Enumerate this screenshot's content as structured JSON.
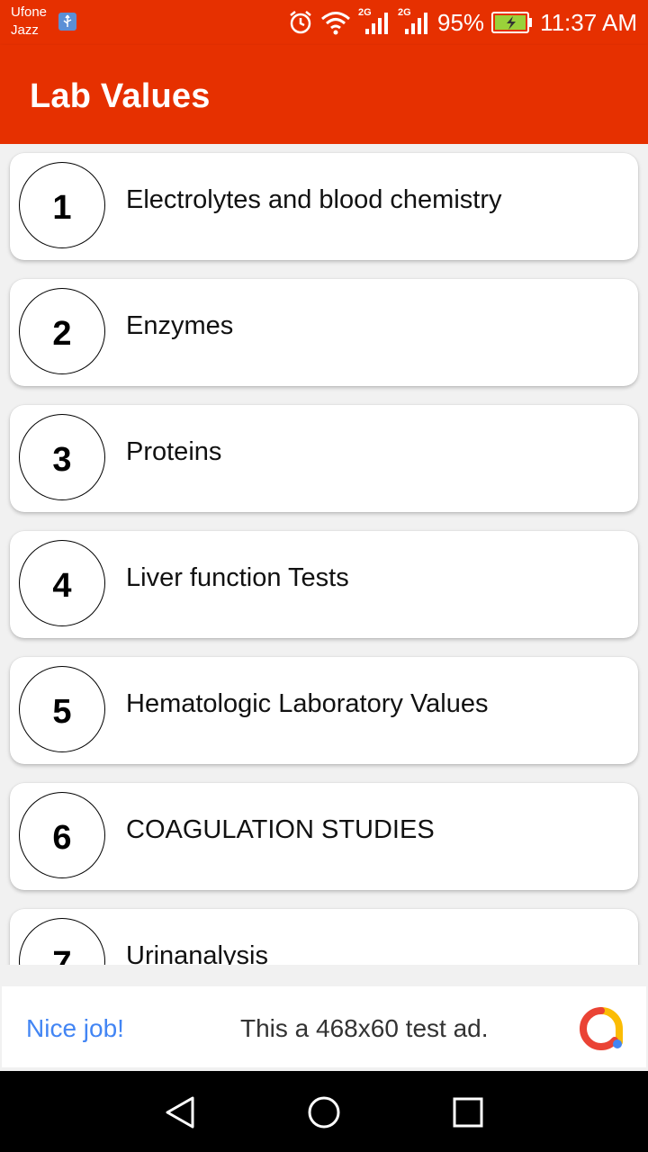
{
  "status_bar": {
    "carrier_line1": "Ufone",
    "carrier_line2": "Jazz",
    "battery_percent": "95%",
    "time": "11:37 AM",
    "network_tag_1": "2G",
    "network_tag_2": "2G"
  },
  "app_bar": {
    "title": "Lab Values"
  },
  "list": {
    "items": [
      {
        "number": "1",
        "label": "Electrolytes and blood chemistry"
      },
      {
        "number": "2",
        "label": "Enzymes"
      },
      {
        "number": "3",
        "label": "Proteins"
      },
      {
        "number": "4",
        "label": "Liver function Tests"
      },
      {
        "number": "5",
        "label": "Hematologic Laboratory Values"
      },
      {
        "number": "6",
        "label": "COAGULATION STUDIES"
      },
      {
        "number": "7",
        "label": "Urinanalysis"
      }
    ]
  },
  "ad": {
    "headline": "Nice job!",
    "body": "This a 468x60 test ad."
  },
  "colors": {
    "app_bar": "#e63000",
    "ad_headline": "#4285f4"
  },
  "icons": {
    "usb": "usb-icon",
    "alarm": "alarm-icon",
    "wifi": "wifi-icon",
    "signal": "signal-icon",
    "battery": "battery-icon",
    "nav_back": "back-triangle-icon",
    "nav_home": "home-circle-icon",
    "nav_recents": "recents-square-icon",
    "ad_logo": "ad-logo-icon"
  }
}
